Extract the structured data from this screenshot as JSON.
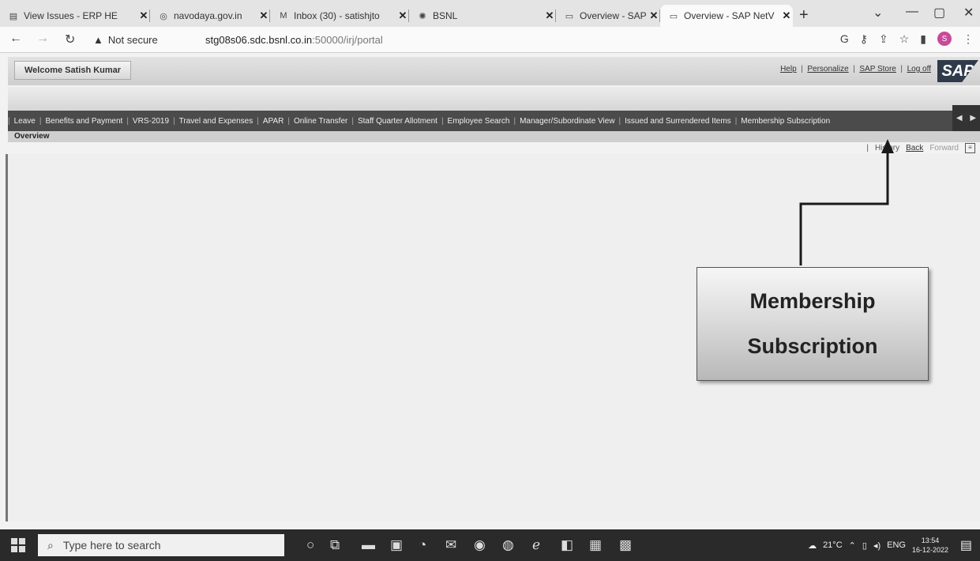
{
  "browser": {
    "tabs": [
      {
        "title": "View Issues - ERP HE",
        "icon": "page-icon",
        "close": "✕"
      },
      {
        "title": "navodaya.gov.in",
        "icon": "globe-icon",
        "close": "✕"
      },
      {
        "title": "Inbox (30) - satishjto",
        "icon": "gmail-icon",
        "close": "✕"
      },
      {
        "title": "BSNL",
        "icon": "bsnl-icon",
        "close": "✕"
      },
      {
        "title": "Overview - SAP NetV",
        "icon": "sap-tab-icon",
        "close": "✕"
      },
      {
        "title": "Overview - SAP NetV",
        "icon": "sap-tab-icon",
        "close": "✕"
      }
    ],
    "new_tab": "+",
    "security_label": "Not secure",
    "url_host": "stg08s06.sdc.bsnl.co.in",
    "url_path": ":50000/irj/portal"
  },
  "sap": {
    "welcome": "Welcome Satish Kumar",
    "links": [
      "Help",
      "Personalize",
      "SAP Store",
      "Log off"
    ],
    "logo": "SAP",
    "nav_items": [
      "Leave",
      "Benefits and Payment",
      "VRS-2019",
      "Travel and Expenses",
      "APAR",
      "Online Transfer",
      "Staff Quarter Allotment",
      "Employee Search",
      "Manager/Subordinate View",
      "Issued and Surrendered Items",
      "Membership Subscription"
    ],
    "page_title": "Overview",
    "history": "History",
    "back": "Back",
    "forward": "Forward"
  },
  "annotation": {
    "line1": "Membership",
    "line2": "Subscription"
  },
  "taskbar": {
    "search_placeholder": "Type here to search",
    "temperature": "21°C",
    "language": "ENG",
    "time": "13:54",
    "date": "16-12-2022"
  }
}
